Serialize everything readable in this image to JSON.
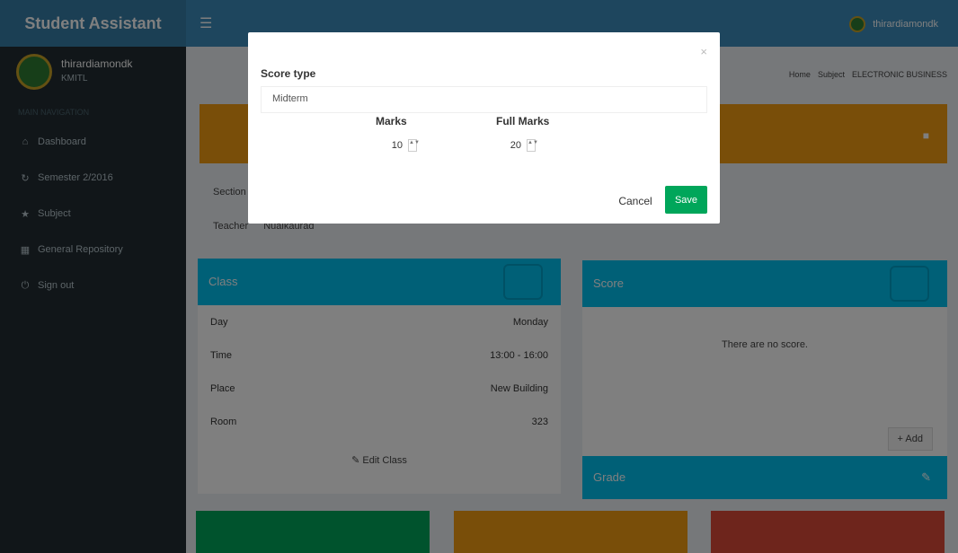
{
  "header": {
    "app_title": "Student Assistant",
    "toggle_icon": "☰",
    "user_name": "thirardiamondk"
  },
  "sidebar": {
    "user_name": "thirardiamondk",
    "user_sub": "KMITL",
    "nav_header": "MAIN NAVIGATION",
    "items": [
      {
        "icon": "⌂",
        "label": "Dashboard"
      },
      {
        "icon": "↻",
        "label": "Semester 2/2016"
      },
      {
        "icon": "★",
        "label": "Subject"
      },
      {
        "icon": "▦",
        "label": "General Repository"
      },
      {
        "icon": "⏻",
        "label": "Sign out"
      }
    ]
  },
  "breadcrumb": {
    "home": "Home",
    "subject": "Subject",
    "current": "ELECTRONIC BUSINESS"
  },
  "subject_info": {
    "section_label": "Section",
    "teacher_label": "Teacher",
    "teacher_value": "Nualkaurad"
  },
  "class_box": {
    "title": "Class",
    "rows": [
      {
        "label": "Day",
        "value": "Monday"
      },
      {
        "label": "Time",
        "value": "13:00 - 16:00"
      },
      {
        "label": "Place",
        "value": "New Building"
      },
      {
        "label": "Room",
        "value": "323"
      }
    ],
    "edit_label": "Edit Class"
  },
  "score_box": {
    "title": "Score",
    "empty_message": "There are no score.",
    "add_label": "Add"
  },
  "grade_box": {
    "title": "Grade"
  },
  "modal": {
    "score_type_label": "Score type",
    "score_type_value": "Midterm",
    "marks_label": "Marks",
    "marks_value": "10",
    "full_marks_label": "Full Marks",
    "full_marks_value": "20",
    "cancel_label": "Cancel",
    "save_label": "Save",
    "close_icon": "×"
  },
  "colors": {
    "header": "#3c8dbc",
    "sidebar": "#222d32",
    "info": "#00c0ef",
    "warning": "#f39c12",
    "success": "#00a65a",
    "danger": "#dd4b39"
  }
}
